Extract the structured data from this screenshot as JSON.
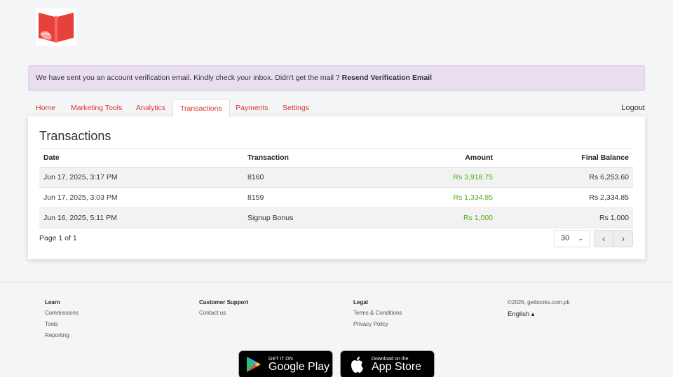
{
  "alert": {
    "message": "We have sent you an account verification email. Kindly check your inbox. Didn't get the mail ? ",
    "link": "Resend Verification Email"
  },
  "tabs": [
    "Home",
    "Marketing Tools",
    "Analytics",
    "Transactions",
    "Payments",
    "Settings"
  ],
  "active_tab": "Transactions",
  "logout": "Logout",
  "page_title": "Transactions",
  "table": {
    "headers": [
      "Date",
      "Transaction",
      "Amount",
      "Final Balance"
    ],
    "rows": [
      {
        "date": "Jun 17, 2025, 3:17 PM",
        "transaction": "8160",
        "amount": "Rs 3,918.75",
        "balance": "Rs 6,253.60"
      },
      {
        "date": "Jun 17, 2025, 3:03 PM",
        "transaction": "8159",
        "amount": "Rs 1,334.85",
        "balance": "Rs 2,334.85"
      },
      {
        "date": "Jun 16, 2025, 5:11 PM",
        "transaction": "Signup Bonus",
        "amount": "Rs 1,000",
        "balance": "Rs 1,000"
      }
    ]
  },
  "pagination": {
    "info": "Page 1 of 1",
    "per_page": "30",
    "prev": "‹",
    "next": "›"
  },
  "footer": {
    "learn": {
      "title": "Learn",
      "links": [
        "Commissions",
        "Tools",
        "Reporting"
      ]
    },
    "support": {
      "title": "Customer Support",
      "links": [
        "Contact us"
      ]
    },
    "legal": {
      "title": "Legal",
      "links": [
        "Terms & Conditions",
        "Privacy Policy"
      ]
    },
    "copyright": "©2026, getbooks.com.pk",
    "language": "English ▴"
  },
  "stores": {
    "google": {
      "small": "GET IT ON",
      "big": "Google Play"
    },
    "apple": {
      "small": "Download on the",
      "big": "App Store"
    }
  },
  "colors": {
    "accent": "#d9342b",
    "amount_green": "#4caf1f",
    "alert_bg": "#e8def0"
  }
}
